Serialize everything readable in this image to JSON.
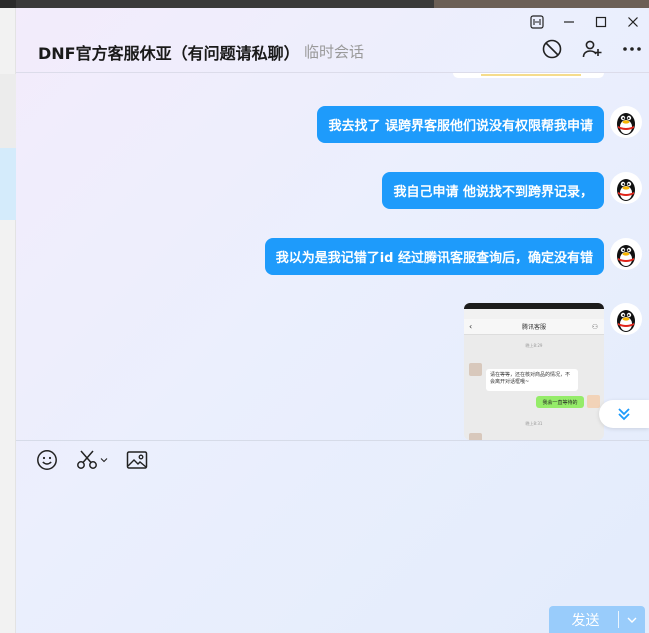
{
  "window": {
    "title": "DNF官方客服休亚（有问题请私聊）",
    "subtitle": "临时会话"
  },
  "header_icons": [
    "pin-icon",
    "minimize-icon",
    "maximize-icon",
    "close-icon",
    "block-icon",
    "add-contact-icon",
    "more-icon"
  ],
  "messages": [
    {
      "text": "我去找了 误跨界客服他们说没有权限帮我申请"
    },
    {
      "text": "我自己申请 他说找不到跨界记录，"
    },
    {
      "text": "我以为是我记错了id  经过腾讯客服查询后，确定没有错"
    }
  ],
  "image_message": {
    "nav_title": "腾讯客服",
    "time1": "晚上8:29",
    "received_text": "请在等等，还在核对商品的情况，不会离开对话框哦~",
    "sent_text": "我会一直等待的",
    "time2": "晚上8:31"
  },
  "toolbar": [
    "emoji-icon",
    "scissors-icon",
    "image-icon"
  ],
  "send": {
    "label": "发送"
  },
  "colors": {
    "bubble": "#1e9bfb",
    "send_button": "#99ccfb",
    "accent": "#1e9bfb"
  }
}
